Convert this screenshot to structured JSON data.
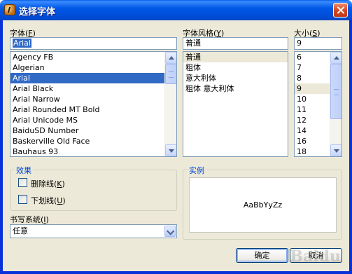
{
  "window": {
    "title": "选择字体"
  },
  "font": {
    "label": "字体",
    "mnemonic": "F",
    "value": "Arial",
    "items": [
      {
        "label": "Agency FB"
      },
      {
        "label": "Algerian"
      },
      {
        "label": "Arial",
        "selected": true
      },
      {
        "label": "Arial Black"
      },
      {
        "label": "Arial Narrow"
      },
      {
        "label": "Arial Rounded MT Bold"
      },
      {
        "label": "Arial Unicode MS"
      },
      {
        "label": "BaiduSD Number"
      },
      {
        "label": "Baskerville Old Face"
      },
      {
        "label": "Bauhaus 93"
      }
    ]
  },
  "style": {
    "label": "字体风格",
    "mnemonic": "Y",
    "value": "普通",
    "items": [
      {
        "label": "普通",
        "selected": true
      },
      {
        "label": "粗体"
      },
      {
        "label": "意大利体"
      },
      {
        "label": "粗体 意大利体"
      }
    ]
  },
  "size": {
    "label": "大小",
    "mnemonic": "S",
    "value": "9",
    "items": [
      {
        "label": "6"
      },
      {
        "label": "7"
      },
      {
        "label": "8"
      },
      {
        "label": "9",
        "selected": true
      },
      {
        "label": "10"
      },
      {
        "label": "11"
      },
      {
        "label": "12"
      },
      {
        "label": "14"
      },
      {
        "label": "16"
      },
      {
        "label": "18"
      }
    ]
  },
  "effects": {
    "title": "效果",
    "strikeout": {
      "label": "删除线",
      "mnemonic": "K",
      "checked": false
    },
    "underline": {
      "label": "下划线",
      "mnemonic": "U",
      "checked": false
    }
  },
  "sample": {
    "title": "实例",
    "text": "AaBbYyZz"
  },
  "script": {
    "label": "书写系统",
    "mnemonic": "I",
    "value": "任意"
  },
  "buttons": {
    "ok": "确定",
    "cancel": "取消"
  },
  "watermark": "Baidu",
  "colors": {
    "titlebar": "#0058e6",
    "selection": "#316ac5",
    "dialog_bg": "#ece9d8",
    "group_title": "#0046d5"
  }
}
